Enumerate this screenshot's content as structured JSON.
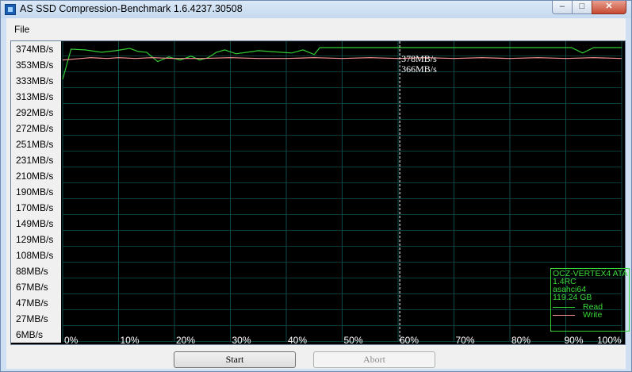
{
  "window": {
    "title": "AS SSD Compression-Benchmark 1.6.4237.30508",
    "controls": {
      "minimize": "–",
      "maximize": "□",
      "close": "✕"
    }
  },
  "menu": {
    "file_label": "File"
  },
  "chart_data": {
    "type": "line",
    "title": "",
    "y_ticks": [
      "374MB/s",
      "353MB/s",
      "333MB/s",
      "313MB/s",
      "292MB/s",
      "272MB/s",
      "251MB/s",
      "231MB/s",
      "210MB/s",
      "190MB/s",
      "170MB/s",
      "149MB/s",
      "129MB/s",
      "108MB/s",
      "88MB/s",
      "67MB/s",
      "47MB/s",
      "27MB/s",
      "6MB/s"
    ],
    "x_ticks": [
      "0%",
      "10%",
      "20%",
      "30%",
      "40%",
      "50%",
      "60%",
      "70%",
      "80%",
      "90%",
      "100%"
    ],
    "ylim": [
      6,
      374
    ],
    "xlim": [
      0,
      100
    ],
    "grid": true,
    "cursor": {
      "x": 60.3,
      "read_label": "378MB/s",
      "write_label": "366MB/s"
    },
    "series": [
      {
        "name": "Read",
        "color": "#33cc33",
        "x": [
          0,
          1.5,
          4,
          7,
          9.5,
          12,
          13.5,
          15,
          17,
          19,
          21,
          23,
          24.5,
          26,
          27.5,
          29,
          31,
          33,
          35,
          37,
          39,
          41,
          43,
          45,
          46,
          48,
          50,
          53,
          56,
          59,
          62,
          65,
          68,
          71,
          74,
          77,
          80,
          83,
          86,
          89,
          91,
          93,
          95,
          97,
          100
        ],
        "y": [
          333,
          370,
          369,
          367,
          370,
          372,
          369,
          367,
          363,
          364,
          358,
          363,
          361,
          360,
          367,
          367,
          365,
          364,
          367,
          366,
          366,
          365,
          367,
          366,
          373,
          373,
          373,
          372,
          374,
          374,
          373,
          373,
          373,
          374,
          373,
          373,
          374,
          373,
          373,
          374,
          374,
          367,
          372,
          372,
          372
        ],
        "line_x": [
          0,
          1.5,
          4,
          7,
          9.5,
          12,
          13.5,
          15,
          17,
          19,
          21,
          23,
          24.5,
          26,
          27.5,
          29,
          31,
          33,
          35,
          37,
          39,
          41,
          43,
          45,
          46,
          48,
          50,
          53,
          56,
          59,
          62,
          65,
          68,
          71,
          74,
          77,
          80,
          83,
          86,
          89,
          91,
          93,
          95,
          97,
          100
        ],
        "line_y": [
          333,
          372,
          371,
          368,
          370,
          373,
          369,
          368,
          356,
          362,
          358,
          363,
          358,
          361,
          368,
          371,
          366,
          368,
          370,
          369,
          368,
          367,
          371,
          365,
          374,
          374,
          374,
          374,
          374,
          374,
          374,
          374,
          374,
          374,
          374,
          374,
          374,
          374,
          374,
          374,
          374,
          367,
          374,
          374,
          374
        ]
      },
      {
        "name": "Write",
        "color": "#ff9494",
        "x": [
          0,
          5,
          8,
          10,
          13,
          16,
          20,
          25,
          30,
          35,
          40,
          45,
          50,
          55,
          60,
          65,
          70,
          75,
          80,
          85,
          90,
          95,
          100
        ],
        "y": [
          358,
          361,
          360,
          361,
          360,
          361,
          360,
          360,
          361,
          360,
          360,
          361,
          360,
          361,
          360,
          361,
          360,
          361,
          360,
          361,
          360,
          361,
          360
        ]
      }
    ]
  },
  "legend": {
    "drive": "OCZ-VERTEX4 ATA",
    "firmware": "1.4RC",
    "driver": "asahci64",
    "size": "119.24 GB",
    "read_label": "Read",
    "write_label": "Write"
  },
  "buttons": {
    "start": "Start",
    "abort": "Abort"
  }
}
